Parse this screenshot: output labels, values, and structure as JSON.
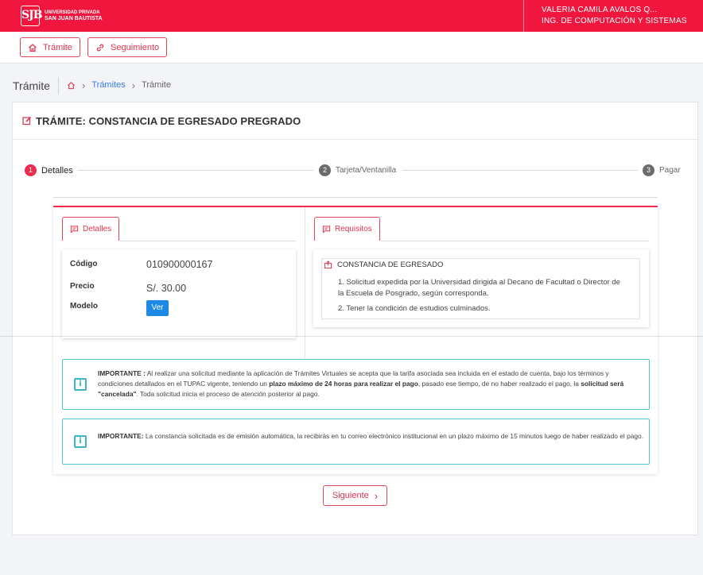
{
  "header": {
    "logo_mark": "SJB",
    "logo_small": "UNIVERSIDAD PRIVADA",
    "logo_big": "SAN JUAN BAUTISTA",
    "user_name": "VALERIA CAMILA AVALOS Q...",
    "user_program": "ING. DE COMPUTACIÓN Y SISTEMAS",
    "color": "#f0163e"
  },
  "nav": {
    "tramite_label": "Trámite",
    "seguimiento_label": "Seguimiento",
    "icons": [
      "home-icon",
      "link-icon"
    ]
  },
  "breadcrumb": {
    "title": "Trámite",
    "items": [
      "Trámites",
      "Trámite"
    ]
  },
  "card": {
    "title": "TRÁMITE: CONSTANCIA DE EGRESADO PREGRADO"
  },
  "stepper": [
    {
      "num": "1",
      "label": "Detalles",
      "active": true
    },
    {
      "num": "2",
      "label": "Tarjeta/Ventanilla",
      "active": false
    },
    {
      "num": "3",
      "label": "Pagar",
      "active": false
    }
  ],
  "details": {
    "tab_label": "Detalles",
    "codigo_label": "Código",
    "codigo_value": "010900000167",
    "precio_label": "Precio",
    "precio_value": "S/. 30.00",
    "modelo_label": "Modelo",
    "ver_label": "Ver"
  },
  "requisitos": {
    "tab_label": "Requisitos",
    "heading": "CONSTANCIA DE EGRESADO",
    "items": [
      "1. Solicitud expedida por la Universidad dirigida al Decano de Facultad o Director de",
      "la Escuela de Posgrado, según corresponda.",
      "2. Tener la condición de estudios culminados."
    ]
  },
  "notices": {
    "n1": {
      "strong": "IMPORTANTE :",
      "p1": " Al realizar una solicitud mediante la aplicación de Trámites Virtuales se acepta que la tarifa asociada sea incluida en el estado de cuenta, bajo los términos y condiciones detallados en el TUPAC vigente, teniendo un ",
      "b1": "plazo máximo de 24 horas para realizar el pago",
      "p2": ", pasado ese tiempo, de no haber realizado el pago, la ",
      "b2": "solicitud será \"cancelada\"",
      "p3": ". Toda solicitud inicia el proceso de atención posterior al pago."
    },
    "n2": {
      "strong": "IMPORTANTE:",
      "p1": " La constancia solicitada es de emisión automática, la recibirás en tu correo electrónico institucional en un plazo máximo de 15 minutos luego de haber realizado el pago."
    }
  },
  "footer": {
    "next_label": "Siguiente"
  },
  "colors": {
    "accent": "#e0344c",
    "info": "#38b6c4",
    "ver_button": "#1e88e5"
  }
}
